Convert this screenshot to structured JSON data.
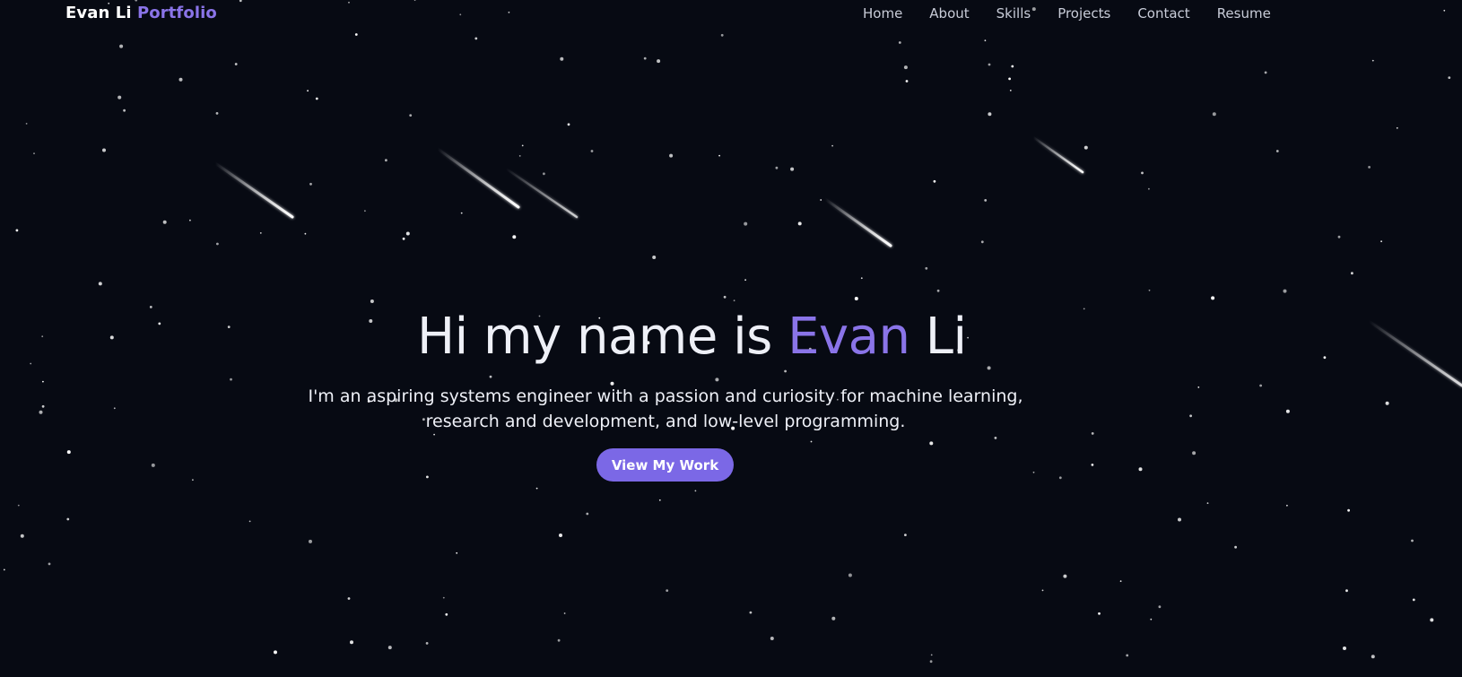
{
  "navbar": {
    "brand_name": "Evan Li",
    "brand_accent": "Portfolio",
    "links": [
      {
        "label": "Home"
      },
      {
        "label": "About"
      },
      {
        "label": "Skills"
      },
      {
        "label": "Projects"
      },
      {
        "label": "Contact"
      },
      {
        "label": "Resume"
      }
    ]
  },
  "hero": {
    "title_prefix": "Hi my name is",
    "title_first": "Evan",
    "title_last": "Li",
    "subtitle": "I'm an aspiring systems engineer with a passion and curiosity for machine learning, research and development, and low-level programming.",
    "cta_label": "View My Work"
  },
  "colors": {
    "background": "#070a13",
    "accent": "#8a74e8",
    "button": "#7b68e6",
    "text": "#eef0f7"
  }
}
